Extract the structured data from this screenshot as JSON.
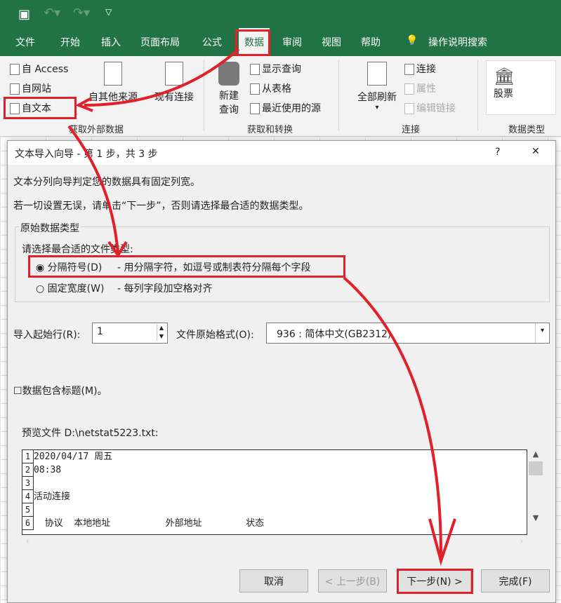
{
  "tabs": [
    "文件",
    "开始",
    "插入",
    "页面布局",
    "公式",
    "数据",
    "审阅",
    "视图",
    "帮助",
    "操作说明搜索"
  ],
  "ribbon": {
    "from_access": "自 Access",
    "from_web": "自网站",
    "from_text": "自文本",
    "from_other": "自其他来源",
    "existing": "现有连接",
    "new_query_1": "新建",
    "new_query_2": "查询",
    "show_query": "显示查询",
    "from_table": "从表格",
    "recent": "最近使用的源",
    "refresh_all": "全部刷新",
    "connections": "连接",
    "properties": "属性",
    "edit_links": "编辑链接",
    "stocks": "股票",
    "groups": [
      "获取外部数据",
      "获取和转换",
      "连接",
      "数据类型"
    ]
  },
  "dialog": {
    "title": "文本导入向导 - 第 1 步，共 3 步",
    "help": "?",
    "close": "✕",
    "line1": "文本分列向导判定您的数据具有固定列宽。",
    "line2": "若一切设置无误，请单击“下一步”，否则请选择最合适的数据类型。",
    "group_title": "原始数据类型",
    "choose": "请选择最合适的文件类型:",
    "opt_delim": "分隔符号(D)",
    "opt_delim_desc": "- 用分隔字符，如逗号或制表符分隔每个字段",
    "opt_fixed": "固定宽度(W)",
    "opt_fixed_desc": "- 每列字段加空格对齐",
    "start_row_label": "导入起始行(R):",
    "start_row": "1",
    "origin_label": "文件原始格式(O):",
    "origin": "936 : 简体中文(GB2312)",
    "headers": "数据包含标题(M)。",
    "preview_label": "预览文件 D:\\netstat5223.txt:",
    "preview": [
      {
        "n": "1",
        "t": "2020/04/17 周五"
      },
      {
        "n": "2",
        "t": "08:38"
      },
      {
        "n": "3",
        "t": ""
      },
      {
        "n": "4",
        "t": "活动连接"
      },
      {
        "n": "5",
        "t": ""
      },
      {
        "n": "6",
        "t": "  协议  本地地址          外部地址        状态"
      }
    ],
    "cancel": "取消",
    "back": "< 上一步(B)",
    "next": "下一步(N) >",
    "finish": "完成(F)"
  },
  "colors": {
    "excel_green": "#217346",
    "annotation": "#e0202a"
  }
}
